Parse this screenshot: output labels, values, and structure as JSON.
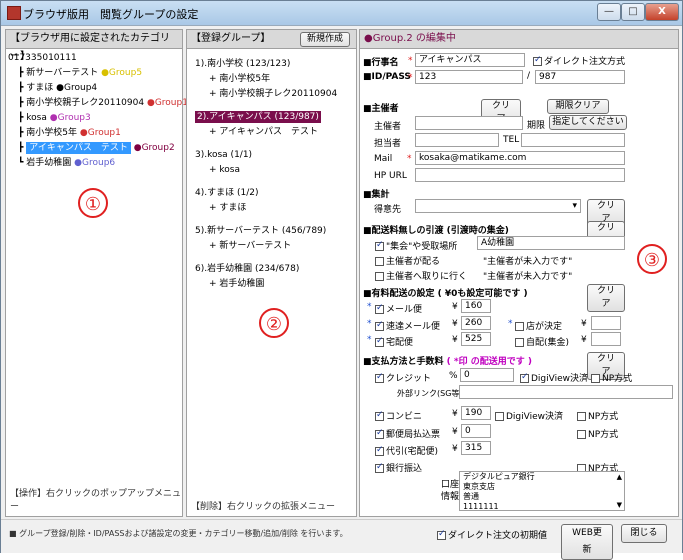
{
  "window": {
    "title": "ブラウザ版用　閲覧グループの設定",
    "min": "—",
    "max": "□",
    "close": "X"
  },
  "left_pane": {
    "header": "【ブラウザ用に設定されたカテゴリー】",
    "root": "017335010111",
    "items": [
      {
        "label": "新サーバーテスト",
        "group": "●Group5",
        "color": "#d8c000"
      },
      {
        "label": "すまほ",
        "group": "●Group4",
        "color": "#000000"
      },
      {
        "label": "南小学校親子レク20110904",
        "group": "●Group1",
        "color": "#d03030"
      },
      {
        "label": "kosa",
        "group": "●Group3",
        "color": "#b030b0"
      },
      {
        "label": "南小学校5年",
        "group": "●Group1",
        "color": "#d03030"
      },
      {
        "label": "アイキャンパス　テスト",
        "group": "●Group2",
        "color": "#800040"
      },
      {
        "label": "岩手幼稚園",
        "group": "●Group6",
        "color": "#6060d0"
      }
    ],
    "badge": "①",
    "footer": "【操作】右クリックのポップアップメニュー"
  },
  "mid_pane": {
    "header": "【登録グループ】",
    "new_button": "新規作成",
    "groups": [
      {
        "title": "1).南小学校 (123/123)",
        "members": [
          "+ 南小学校5年",
          "+ 南小学校親子レク20110904"
        ]
      },
      {
        "title": "2).アイキャンパス (123/987)",
        "members": [
          "+ アイキャンパス　テスト"
        ]
      },
      {
        "title": "3).kosa (1/1)",
        "members": [
          "+ kosa"
        ]
      },
      {
        "title": "4).すまほ (1/2)",
        "members": [
          "+ すまほ"
        ]
      },
      {
        "title": "5).新サーバーテスト (456/789)",
        "members": [
          "+ 新サーバーテスト"
        ]
      },
      {
        "title": "6).岩手幼稚園 (234/678)",
        "members": [
          "+ 岩手幼稚園"
        ]
      }
    ],
    "badge": "②",
    "footer": "【削除】右クリックの拡張メニュー"
  },
  "right_pane": {
    "header": "●Group.2 の編集中",
    "event_label": "■行事名",
    "event_value": "アイキャンパス",
    "direct_order": "ダイレクト注文方式",
    "idpass_label": "■ID/PASS",
    "id_value": "123",
    "pass_sep": "/",
    "pass_value": "987",
    "organizer_label": "■主催者",
    "clear": "クリア",
    "period_clear": "期限クリア",
    "organizer": "主催者",
    "deadline": "期限",
    "deadline_btn": "指定してください",
    "contact": "担当者",
    "tel": "TEL",
    "mail": "Mail",
    "mail_value": "kosaka@matikame.com",
    "hp": "HP URL",
    "collect_label": "■集計",
    "customer": "得意先",
    "pickup_label": "■配送料無しの引渡 (引渡時の集金)",
    "pickup_1": "\"集会\"や受取場所",
    "pickup_1_value": "A幼稚園",
    "pickup_2": "主催者が配る",
    "pickup_2_note": "\"主催者が未入力です\"",
    "pickup_3": "主催者へ取りに行く",
    "pickup_3_note": "\"主催者が未入力です\"",
    "paid_label": "■有料配送の設定 ( ¥0も設定可能です )",
    "mail_bin": "メール便",
    "mail_bin_val": "160",
    "fast_mail": "速達メール便",
    "fast_mail_val": "260",
    "shop_decide": "店が決定",
    "home": "宅配便",
    "home_val": "525",
    "self_collect": "自配(集金)",
    "yen": "¥",
    "pay_label": "■支払方法と手数料",
    "pay_note": "( *印 の配送用です )",
    "credit": "クレジット",
    "percent": "%",
    "credit_val": "0",
    "digiview": "DigiView決済",
    "np": "NP方式",
    "ext_link": "外部リンク(SG等)",
    "conv": "コンビニ",
    "conv_val": "190",
    "postal": "郵便局払込票",
    "postal_val": "0",
    "cod": "代引(宅配便)",
    "cod_val": "315",
    "bank": "銀行振込",
    "account": "口座",
    "info": "情報",
    "bank_text": [
      "デジタルピュア銀行",
      "東京支店",
      "普通",
      "1111111"
    ],
    "badge": "③"
  },
  "statusbar": {
    "text": "■ グループ登録/削除・ID/PASSおよび諸設定の変更・カテゴリー移動/追加/削除 を行います。",
    "direct_default": "ダイレクト注文の初期値",
    "web_update": "WEB更新",
    "close": "閉じる"
  }
}
